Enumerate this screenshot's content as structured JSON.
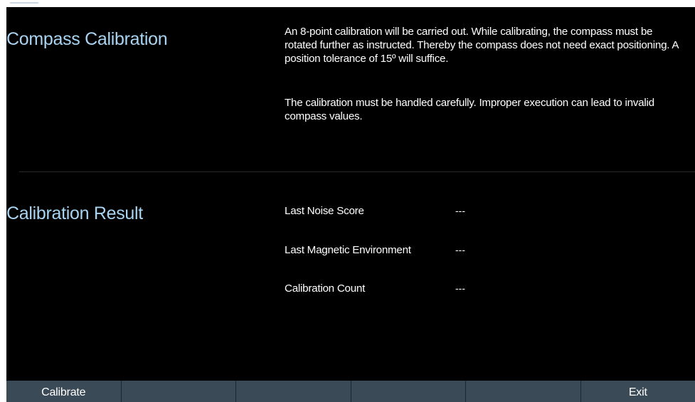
{
  "sections": {
    "compass_title": "Compass Calibration",
    "description_p1": "An 8-point calibration will be carried out. While calibrating, the compass must be rotated further as instructed. Thereby the compass does not need exact positioning. A position tolerance of 15º will suffice.",
    "description_p2": "The calibration must be handled carefully. Improper execution can lead to invalid compass values.",
    "result_title": "Calibration Result"
  },
  "results": [
    {
      "label": "Last Noise Score",
      "value": "---"
    },
    {
      "label": "Last Magnetic Environment",
      "value": "---"
    },
    {
      "label": "Calibration Count",
      "value": "---"
    }
  ],
  "softkeys": [
    "Calibrate",
    "",
    "",
    "",
    "",
    "Exit"
  ],
  "colors": {
    "background": "#000000",
    "title": "#a8d4f2",
    "softkey_bar": "#3b4a57",
    "text": "#ffffff"
  }
}
